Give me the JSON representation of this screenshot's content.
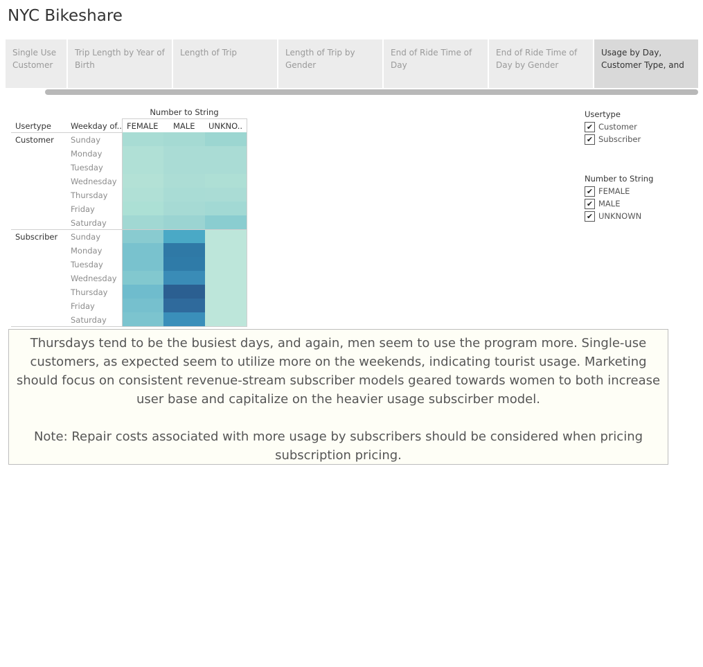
{
  "app": {
    "title": "NYC Bikeshare"
  },
  "tabs": [
    {
      "label": "Single Use Customer vs..",
      "active": false
    },
    {
      "label": "Trip Length by Year of Birth",
      "active": false
    },
    {
      "label": "Length of Trip",
      "active": false
    },
    {
      "label": "Length of Trip by Gender",
      "active": false
    },
    {
      "label": "End of Ride Time of Day",
      "active": false
    },
    {
      "label": "End of Ride Time of Day by Gender",
      "active": false
    },
    {
      "label": "Usage by Day, Customer Type, and G..",
      "active": true
    }
  ],
  "heatmap": {
    "column_group_title": "Number to String",
    "row_header_usertype": "Usertype",
    "row_header_weekday": "Weekday of..",
    "columns": [
      "FEMALE",
      "MALE",
      "UNKNO.."
    ],
    "groups": [
      {
        "usertype": "Customer",
        "weekdays": [
          "Sunday",
          "Monday",
          "Tuesday",
          "Wednesday",
          "Thursday",
          "Friday",
          "Saturday"
        ],
        "colors": [
          [
            "#a8dcd4",
            "#a5dad3",
            "#9cd6d1"
          ],
          [
            "#b0e0d6",
            "#aadcd5",
            "#aadcd5"
          ],
          [
            "#b0e0d6",
            "#aadcd5",
            "#aadcd5"
          ],
          [
            "#b3e1d6",
            "#acddd5",
            "#aedfd5"
          ],
          [
            "#b0e0d6",
            "#a9dcd5",
            "#aadcd5"
          ],
          [
            "#ace0d5",
            "#a6dad4",
            "#a2d9d4"
          ],
          [
            "#a1d8d3",
            "#9bd4d2",
            "#8acdd0"
          ]
        ]
      },
      {
        "usertype": "Subscriber",
        "weekdays": [
          "Sunday",
          "Monday",
          "Tuesday",
          "Wednesday",
          "Thursday",
          "Friday",
          "Saturday"
        ],
        "colors": [
          [
            "#89cbd0",
            "#4aa9c6",
            "#bde6da"
          ],
          [
            "#79c2ce",
            "#2f79a6",
            "#bde6da"
          ],
          [
            "#79c2ce",
            "#2f7ba8",
            "#bde6da"
          ],
          [
            "#82c8cf",
            "#3a8cb7",
            "#bde6da"
          ],
          [
            "#6fbccd",
            "#2b5f91",
            "#bde6da"
          ],
          [
            "#76c0ce",
            "#2f6a9c",
            "#bde6da"
          ],
          [
            "#7cc4cf",
            "#3a8fba",
            "#bde6da"
          ]
        ]
      }
    ]
  },
  "legends": {
    "usertype": {
      "title": "Usertype",
      "items": [
        "Customer",
        "Subscriber"
      ]
    },
    "gender": {
      "title": "Number to String",
      "items": [
        "FEMALE",
        "MALE",
        "UNKNOWN"
      ]
    },
    "check_glyph": "✔"
  },
  "annotation": {
    "paragraph1": "Thursdays tend to be the busiest days, and again, men seem to use the program more.  Single-use customers, as expected seem to utilize more on the weekends, indicating tourist usage.  Marketing should focus on consistent revenue-stream subscriber models geared towards women to both increase user base and capitalize on the heavier usage subscirber model.",
    "paragraph2": "Note:  Repair costs associated with more usage by subscribers should be considered when pricing subscription pricing."
  }
}
